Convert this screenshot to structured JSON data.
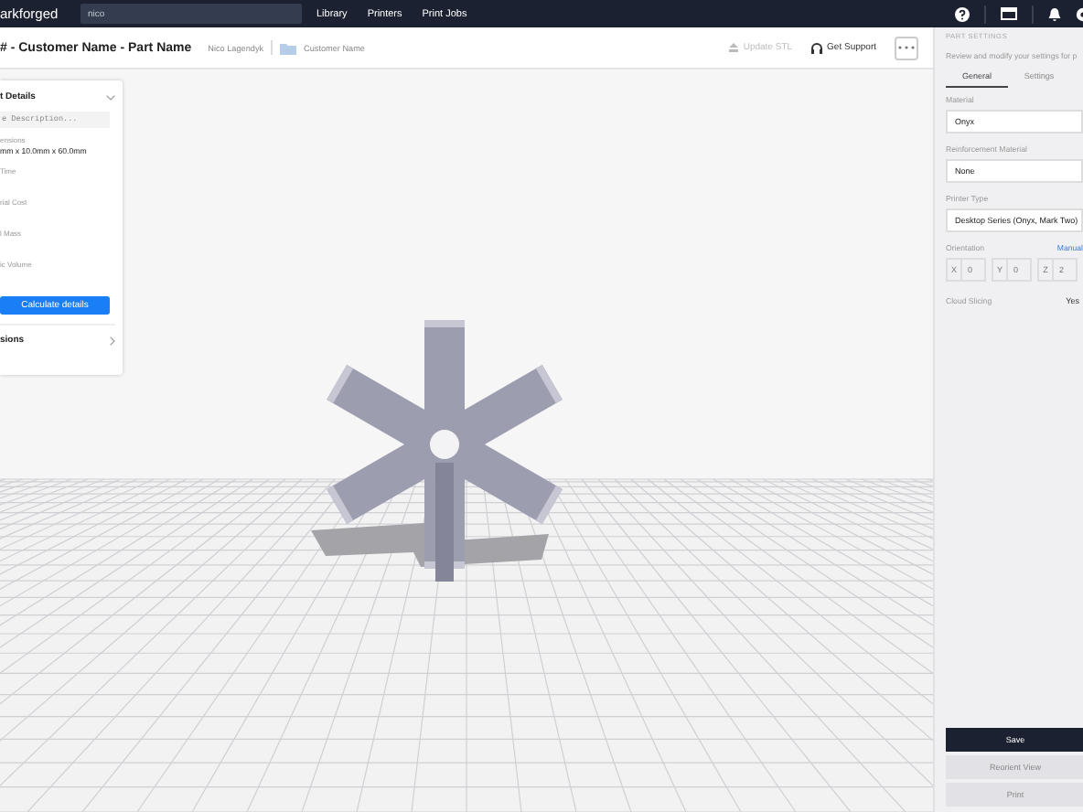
{
  "topbar": {
    "logo": "arkforged",
    "search": {
      "value": "nico"
    },
    "nav": [
      "Library",
      "Printers",
      "Print Jobs"
    ]
  },
  "header": {
    "title": "# - Customer Name - Part Name",
    "owner": "Nico Lagendyk",
    "folder": "Customer Name",
    "actions": [
      {
        "label": "Update STL",
        "disabled": true,
        "kind": "upload"
      },
      {
        "label": "Get Support",
        "disabled": false,
        "kind": "support"
      }
    ]
  },
  "details": {
    "title": "t Details",
    "description": {
      "placeholder": "e Description..."
    },
    "fields": [
      {
        "label": "ensions",
        "value": "mm x 10.0mm x 60.0mm"
      },
      {
        "label": "Time"
      },
      {
        "label": "rial Cost"
      },
      {
        "label": "l Mass"
      },
      {
        "label": "ic Volume"
      }
    ],
    "button": "Calculate details",
    "footer": "sions"
  },
  "settings": {
    "heading": "PART SETTINGS",
    "subtitle": "Review and modify your settings for p",
    "tabs": [
      {
        "label": "General",
        "selected": true
      },
      {
        "label": "Settings",
        "selected": false
      }
    ],
    "selects": [
      {
        "label": "Material",
        "value": "Onyx"
      },
      {
        "label": "Reinforcement Material",
        "value": "None"
      },
      {
        "label": "Printer Type",
        "value": "Desktop Series (Onyx, Mark Two)"
      }
    ],
    "orientation": {
      "label": "Orientation",
      "mode": "Manual",
      "axes": [
        {
          "axis": "X",
          "value": "0"
        },
        {
          "axis": "Y",
          "value": "0"
        },
        {
          "axis": "Z",
          "value": "2"
        }
      ]
    },
    "cloud_slicing": {
      "label": "Cloud Slicing",
      "value": "Yes"
    },
    "buttons": [
      {
        "label": "Save",
        "disabled": false
      },
      {
        "label": "Reorient View",
        "disabled": true
      },
      {
        "label": "Print",
        "disabled": true
      }
    ]
  }
}
